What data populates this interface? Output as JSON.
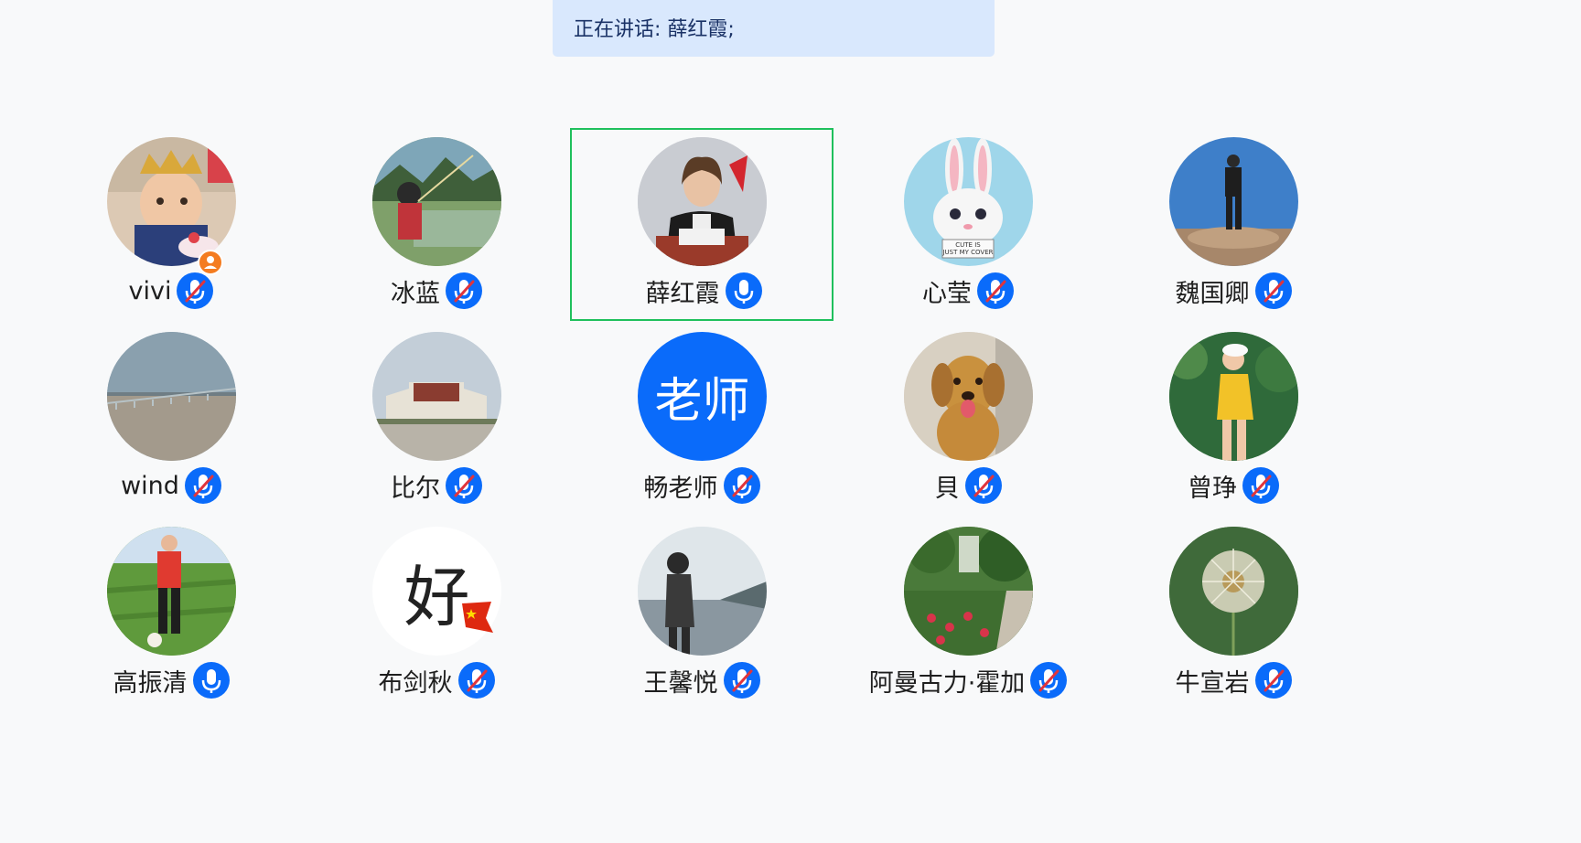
{
  "speaking": {
    "text": "正在讲话: 薛红霞;"
  },
  "participants": [
    {
      "name": "vivi",
      "mic": "muted",
      "avatar": "photo-child-birthday",
      "host": true
    },
    {
      "name": "冰蓝",
      "mic": "muted",
      "avatar": "photo-girl-fishing"
    },
    {
      "name": "薛红霞",
      "mic": "on",
      "avatar": "photo-woman-at-desk",
      "selected": true
    },
    {
      "name": "心莹",
      "mic": "muted",
      "avatar": "photo-white-rabbit"
    },
    {
      "name": "魏国卿",
      "mic": "muted",
      "avatar": "photo-man-on-rock"
    },
    {
      "name": "wind",
      "mic": "muted",
      "avatar": "photo-bridge-sea"
    },
    {
      "name": "比尔",
      "mic": "muted",
      "avatar": "photo-palace"
    },
    {
      "name": "畅老师",
      "mic": "muted",
      "avatar_text": "老师",
      "avatar_color": "#0a6bfa"
    },
    {
      "name": "貝",
      "mic": "muted",
      "avatar": "photo-golden-dog"
    },
    {
      "name": "曾琤",
      "mic": "muted",
      "avatar": "photo-woman-yellow-forest"
    },
    {
      "name": "高振清",
      "mic": "on",
      "avatar": "photo-man-red-football"
    },
    {
      "name": "布剑秋",
      "mic": "muted",
      "avatar_text": "好",
      "avatar_color": "#ffffff",
      "flag": true
    },
    {
      "name": "王馨悦",
      "mic": "muted",
      "avatar": "photo-woman-sea-silhouette"
    },
    {
      "name": "阿曼古力·霍加",
      "mic": "muted",
      "avatar": "photo-garden"
    },
    {
      "name": "牛宣岩",
      "mic": "muted",
      "avatar": "photo-dandelion"
    }
  ],
  "colors": {
    "mic_blue": "#0a6bfa",
    "mute_slash": "#e0343c",
    "selected_border": "#1fc05c",
    "speaking_bg": "#d9e8fd",
    "host_orange": "#f47c20"
  }
}
